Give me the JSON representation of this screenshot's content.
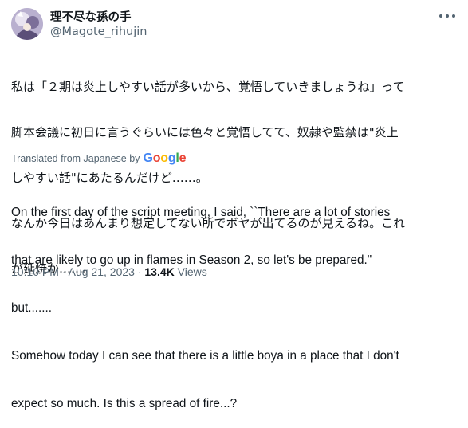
{
  "tweet": {
    "display_name": "理不尽な孫の手",
    "handle": "@Magote_rihujin",
    "japanese_lines": [
      "私は「２期は炎上しやすい話が多いから、覚悟していきましょうね」って",
      "脚本会議に初日に言うぐらいには色々と覚悟してて、奴隷や監禁は\"炎上",
      "しやすい話\"にあたるんだけど……。",
      "なんか今日はあんまり想定してない所でボヤが出てるのが見えるね。これ",
      "が延焼か……。"
    ],
    "translated_label": "Translated from Japanese by",
    "translator": "Google",
    "translator_colors": [
      "#4285F4",
      "#EA4335",
      "#FBBC05",
      "#4285F4",
      "#34A853",
      "#EA4335"
    ],
    "english_lines": [
      "On the first day of the script meeting, I said, ``There are a lot of stories",
      "that are likely to go up in flames in Season 2, so let's be prepared.\"",
      "but.......",
      "Somehow today I can see that there is a little boya in a place that I don't",
      "expect so much. Is this a spread of fire...?"
    ],
    "time": "10:10 PM",
    "date": "Aug 21, 2023",
    "separator": "·",
    "views_count": "13.4K",
    "views_label": "Views"
  }
}
